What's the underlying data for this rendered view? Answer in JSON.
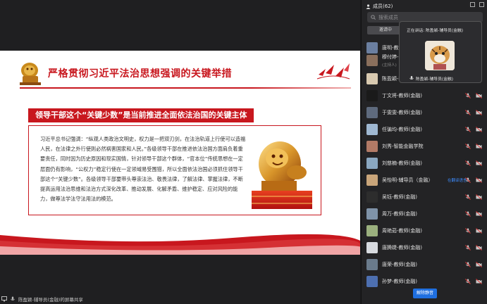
{
  "slide": {
    "title": "严格贯彻习近平法治思想强调的关键举措",
    "banner": "领导干部这个“关键少数”是当前推进全面依法治国的关键主体",
    "quote": "习近平总书记强调：“纵观人类政治文明史，权力是一把双刃剑，在法治轨道上行使可以造福人民，在法律之外行使则必然祸害国家和人民。”各级领导干部在推进依法治国方面肩负着重要责任，同时因为历史原因和现实国情，针对领导干部这个群体，“官本位”传统思想在一定层面仍有影响，“公权力”稳定行使在一定领域易受围猎，所以全面依法治国必须抓住领导干部这个“关键少数”。各级领导干部要带头尊崇法治、敬畏法律，了解法律、掌握法律，不断提高运用法治思维和法治方式深化改革、推动发展、化解矛盾、维护稳定、应对风险的能力，做尊法学法守法用法的模范。"
  },
  "status": {
    "share_text": "陈盈颖-辅导员(金融)的屏幕共享"
  },
  "panel": {
    "title": "成员(62)",
    "search_placeholder": "搜索成员",
    "invite_label": "邀请中",
    "speaking_label": "正在讲话: 陈盈颖-辅导员(金融)",
    "speaking_name": "陈盈颖-辅导员(金融)",
    "unmute_label": "解除静音",
    "members": [
      {
        "name": "唐明-教…",
        "sub": "",
        "tag": "",
        "color": "#6b7fa0"
      },
      {
        "name": "穆付婷-…",
        "sub": "(主持人)",
        "tag": "",
        "color": "#8a6f5c"
      },
      {
        "name": "陈盈颖-辅导员",
        "sub": "",
        "tag": "",
        "color": "#d8c9b0"
      },
      {
        "name": "丁文将-教师(金融)",
        "sub": "",
        "tag": "",
        "color": "#1a1a1a"
      },
      {
        "name": "于雯雯-教师(金融)",
        "sub": "",
        "tag": "",
        "color": "#5e6a7d"
      },
      {
        "name": "任骗均-教师(金融)",
        "sub": "",
        "tag": "",
        "color": "#9fb8d2"
      },
      {
        "name": "刘秀-智能金融学院",
        "sub": "",
        "tag": "",
        "color": "#b27a66"
      },
      {
        "name": "刘慈楠-教师(金融)",
        "sub": "",
        "tag": "",
        "color": "#8aa7c0"
      },
      {
        "name": "吴怡明-辅导员（金融）",
        "sub": "",
        "tag": "在翻译语言",
        "color": "#c9a57a"
      },
      {
        "name": "吴钰-教师(金融)",
        "sub": "",
        "tag": "",
        "color": "#2d2d2d"
      },
      {
        "name": "周万-教师(金融)",
        "sub": "",
        "tag": "",
        "color": "#7f93a8"
      },
      {
        "name": "周艳茹-教师(金融)",
        "sub": "",
        "tag": "",
        "color": "#9bb07e"
      },
      {
        "name": "唐腾婕-教师(金融)",
        "sub": "",
        "tag": "",
        "color": "#d8dbe0"
      },
      {
        "name": "唐荣-教师(金融)",
        "sub": "",
        "tag": "",
        "color": "#6a7b8c"
      },
      {
        "name": "孙梦-教师(金融)",
        "sub": "",
        "tag": "",
        "color": "#4d6fb0"
      }
    ]
  }
}
